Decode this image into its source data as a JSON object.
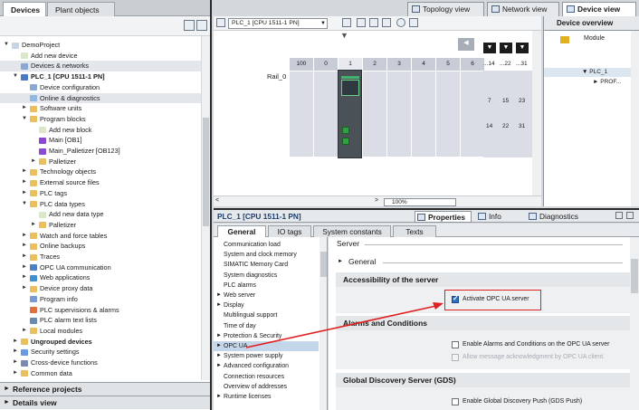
{
  "left": {
    "tabs": [
      "Devices",
      "Plant objects"
    ],
    "tree": [
      {
        "label": "DemoProject",
        "level": 0,
        "arrow": "down",
        "icon": "project",
        "bold": false
      },
      {
        "label": "Add new device",
        "level": 1,
        "arrow": "",
        "icon": "add",
        "bold": false
      },
      {
        "label": "Devices & networks",
        "level": 1,
        "arrow": "",
        "icon": "network",
        "bold": false,
        "selected": true
      },
      {
        "label": "PLC_1 [CPU 1511-1 PN]",
        "level": 1,
        "arrow": "down",
        "icon": "plc",
        "bold": true
      },
      {
        "label": "Device configuration",
        "level": 2,
        "arrow": "",
        "icon": "config",
        "bold": false
      },
      {
        "label": "Online & diagnostics",
        "level": 2,
        "arrow": "",
        "icon": "online",
        "bold": false,
        "selected": true
      },
      {
        "label": "Software units",
        "level": 2,
        "arrow": "right",
        "icon": "folder",
        "bold": false
      },
      {
        "label": "Program blocks",
        "level": 2,
        "arrow": "down",
        "icon": "folder",
        "bold": false
      },
      {
        "label": "Add new block",
        "level": 3,
        "arrow": "",
        "icon": "add",
        "bold": false
      },
      {
        "label": "Main [OB1]",
        "level": 3,
        "arrow": "",
        "icon": "block",
        "bold": false
      },
      {
        "label": "Main_Palletizer [OB123]",
        "level": 3,
        "arrow": "",
        "icon": "block",
        "bold": false
      },
      {
        "label": "Palletizer",
        "level": 3,
        "arrow": "right",
        "icon": "folder",
        "bold": false
      },
      {
        "label": "Technology objects",
        "level": 2,
        "arrow": "right",
        "icon": "folder",
        "bold": false
      },
      {
        "label": "External source files",
        "level": 2,
        "arrow": "right",
        "icon": "folder",
        "bold": false
      },
      {
        "label": "PLC tags",
        "level": 2,
        "arrow": "right",
        "icon": "folder",
        "bold": false
      },
      {
        "label": "PLC data types",
        "level": 2,
        "arrow": "down",
        "icon": "folder",
        "bold": false
      },
      {
        "label": "Add new data type",
        "level": 3,
        "arrow": "",
        "icon": "add",
        "bold": false
      },
      {
        "label": "Palletizer",
        "level": 3,
        "arrow": "right",
        "icon": "folder",
        "bold": false
      },
      {
        "label": "Watch and force tables",
        "level": 2,
        "arrow": "right",
        "icon": "folder",
        "bold": false
      },
      {
        "label": "Online backups",
        "level": 2,
        "arrow": "right",
        "icon": "folder",
        "bold": false
      },
      {
        "label": "Traces",
        "level": 2,
        "arrow": "right",
        "icon": "folder",
        "bold": false
      },
      {
        "label": "OPC UA communication",
        "level": 2,
        "arrow": "right",
        "icon": "opc",
        "bold": false
      },
      {
        "label": "Web applications",
        "level": 2,
        "arrow": "right",
        "icon": "web",
        "bold": false
      },
      {
        "label": "Device proxy data",
        "level": 2,
        "arrow": "right",
        "icon": "folder",
        "bold": false
      },
      {
        "label": "Program info",
        "level": 2,
        "arrow": "",
        "icon": "info",
        "bold": false
      },
      {
        "label": "PLC supervisions & alarms",
        "level": 2,
        "arrow": "",
        "icon": "alarm",
        "bold": false
      },
      {
        "label": "PLC alarm text lists",
        "level": 2,
        "arrow": "",
        "icon": "list",
        "bold": false
      },
      {
        "label": "Local modules",
        "level": 2,
        "arrow": "right",
        "icon": "folder",
        "bold": false
      },
      {
        "label": "Ungrouped devices",
        "level": 1,
        "arrow": "right",
        "icon": "folder",
        "bold": true
      },
      {
        "label": "Security settings",
        "level": 1,
        "arrow": "right",
        "icon": "security",
        "bold": false
      },
      {
        "label": "Cross-device functions",
        "level": 1,
        "arrow": "right",
        "icon": "cross",
        "bold": false
      },
      {
        "label": "Common data",
        "level": 1,
        "arrow": "right",
        "icon": "folder",
        "bold": false
      }
    ],
    "bottom": [
      "Reference projects",
      "Details view"
    ]
  },
  "views": {
    "tabs": [
      "Topology view",
      "Network view",
      "Device view"
    ]
  },
  "device": {
    "plc_select": "PLC_1 [CPU 1511-1 PN]",
    "rail_label": "Rail_0",
    "slots": [
      "100",
      "0",
      "1",
      "2",
      "3",
      "4",
      "5",
      "6",
      "...14",
      "...22",
      "...31"
    ],
    "ext_rows": [
      [
        "7",
        "15",
        "23"
      ],
      [
        "14",
        "22",
        "31"
      ]
    ],
    "zoom": "100%"
  },
  "overview": {
    "title": "Device overview",
    "col_module": "Module",
    "rows": [
      "PLC_1",
      "PROF..."
    ]
  },
  "inspector": {
    "title": "PLC_1 [CPU 1511-1 PN]",
    "tabs": [
      "Properties",
      "Info",
      "Diagnostics"
    ],
    "subtabs": [
      "General",
      "IO tags",
      "System constants",
      "Texts"
    ],
    "nav": [
      {
        "label": "Communication load",
        "arrow": ""
      },
      {
        "label": "System and clock memory",
        "arrow": ""
      },
      {
        "label": "SIMATIC Memory Card",
        "arrow": ""
      },
      {
        "label": "System diagnostics",
        "arrow": ""
      },
      {
        "label": "PLC alarms",
        "arrow": ""
      },
      {
        "label": "Web server",
        "arrow": "right"
      },
      {
        "label": "Display",
        "arrow": "right"
      },
      {
        "label": "Multilingual support",
        "arrow": ""
      },
      {
        "label": "Time of day",
        "arrow": ""
      },
      {
        "label": "Protection & Security",
        "arrow": "right"
      },
      {
        "label": "OPC UA",
        "arrow": "right",
        "selected": true
      },
      {
        "label": "System power supply",
        "arrow": "right"
      },
      {
        "label": "Advanced configuration",
        "arrow": "right"
      },
      {
        "label": "Connection resources",
        "arrow": ""
      },
      {
        "label": "Overview of addresses",
        "arrow": ""
      },
      {
        "label": "Runtime licenses",
        "arrow": "right"
      }
    ],
    "content": {
      "heading": "Server",
      "general": "General",
      "sections": [
        {
          "title": "Accessibility of the server",
          "options": [
            {
              "label": "Activate OPC UA server",
              "checked": true,
              "disabled": false
            }
          ]
        },
        {
          "title": "Alarms and Conditions",
          "options": [
            {
              "label": "Enable Alarms and Conditions on the OPC UA server",
              "checked": false,
              "disabled": false
            },
            {
              "label": "Allow message acknowledgment by OPC UA client.",
              "checked": false,
              "disabled": true
            }
          ]
        },
        {
          "title": "Global Discovery Server (GDS)",
          "options": [
            {
              "label": "Enable Global Discovery Push (GDS Push)",
              "checked": false,
              "disabled": false
            }
          ]
        }
      ]
    }
  },
  "colors": {
    "highlight": "#e02020",
    "selected_nav": "#c4d6ea",
    "checkbox_checked": "#2e6fc0"
  }
}
